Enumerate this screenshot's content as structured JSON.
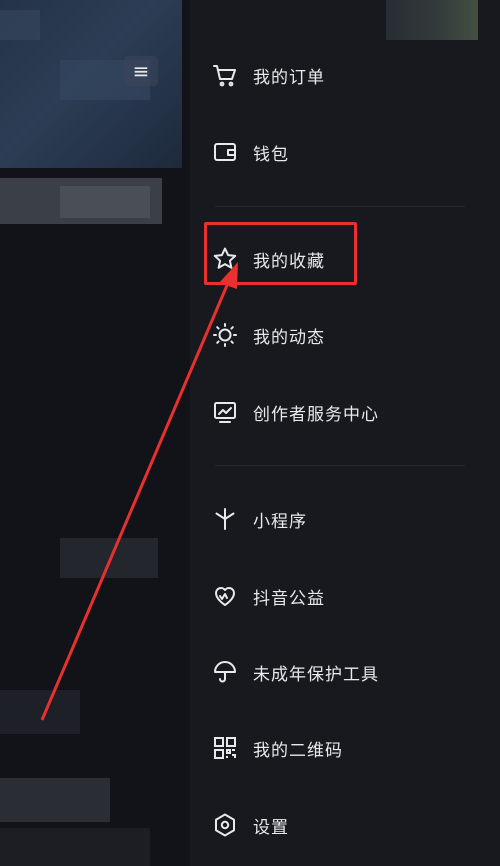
{
  "header": {
    "menu_icon": "hamburger-icon"
  },
  "drawer": {
    "items": [
      {
        "label": "我的订单",
        "icon": "cart-icon"
      },
      {
        "label": "钱包",
        "icon": "wallet-icon"
      },
      {
        "label": "我的收藏",
        "icon": "star-icon"
      },
      {
        "label": "我的动态",
        "icon": "sun-icon"
      },
      {
        "label": "创作者服务中心",
        "icon": "chart-monitor-icon"
      },
      {
        "label": "小程序",
        "icon": "asterisk-icon"
      },
      {
        "label": "抖音公益",
        "icon": "heart-icon"
      },
      {
        "label": "未成年保护工具",
        "icon": "umbrella-icon"
      },
      {
        "label": "我的二维码",
        "icon": "qrcode-icon"
      },
      {
        "label": "设置",
        "icon": "settings-icon"
      }
    ]
  },
  "annotation": {
    "highlight_color": "#e8302e"
  }
}
